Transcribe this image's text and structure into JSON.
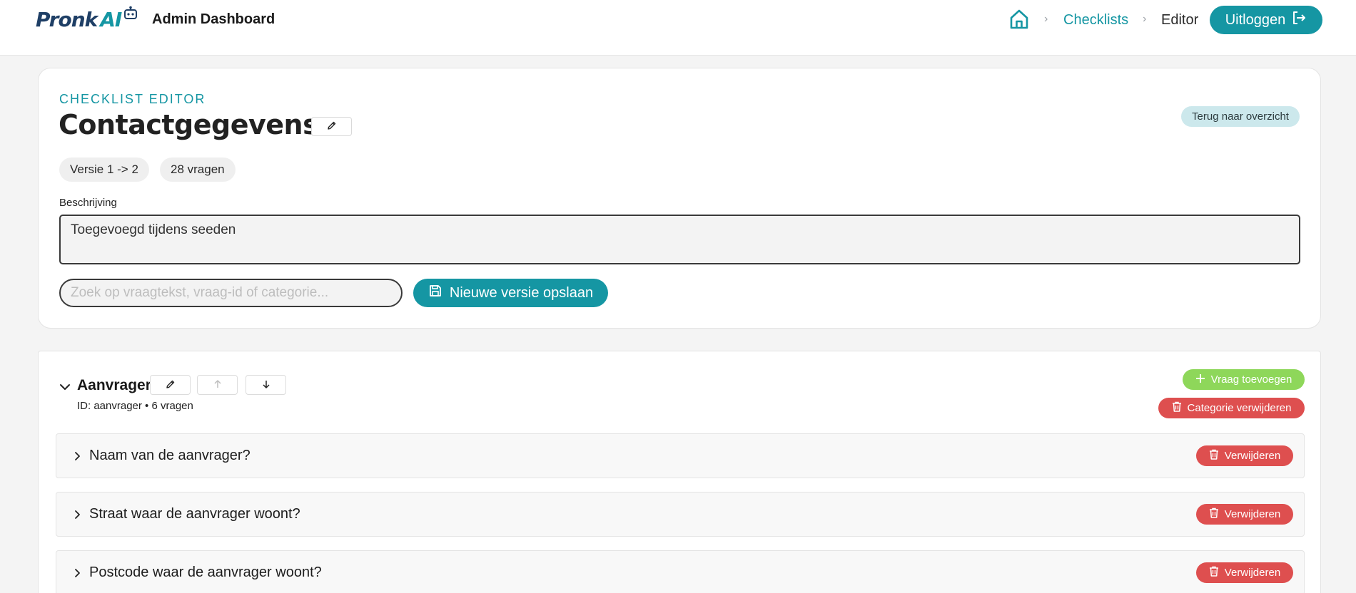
{
  "header": {
    "logo_main": "Pronk",
    "logo_accent": "AI",
    "app_title": "Admin Dashboard",
    "breadcrumb": {
      "home_icon": "home-icon",
      "separator": "›",
      "items": [
        "Checklists",
        "Editor"
      ]
    },
    "logout_label": "Uitloggen"
  },
  "editor": {
    "eyebrow": "CHECKLIST EDITOR",
    "title": "Contactgegevens",
    "back_label": "Terug naar overzicht",
    "version_chip": "Versie 1 -> 2",
    "count_chip": "28 vragen",
    "description_label": "Beschrijving",
    "description_value": "Toegevoegd tijdens seeden",
    "search_placeholder": "Zoek op vraagtekst, vraag-id of categorie...",
    "save_label": "Nieuwe versie opslaan"
  },
  "category": {
    "title": "Aanvrager",
    "meta": "ID: aanvrager • 6 vragen",
    "add_question_label": "Vraag toevoegen",
    "delete_category_label": "Categorie verwijderen",
    "questions": [
      {
        "text": "Naam van de aanvrager?",
        "delete_label": "Verwijderen"
      },
      {
        "text": "Straat waar de aanvrager woont?",
        "delete_label": "Verwijderen"
      },
      {
        "text": "Postcode waar de aanvrager woont?",
        "delete_label": "Verwijderen"
      }
    ]
  },
  "colors": {
    "accent": "#1596a3",
    "brand_dark": "#1f3f66",
    "success": "#8ed75a",
    "danger": "#de4f4f",
    "soft_accent": "#cce8ec"
  }
}
